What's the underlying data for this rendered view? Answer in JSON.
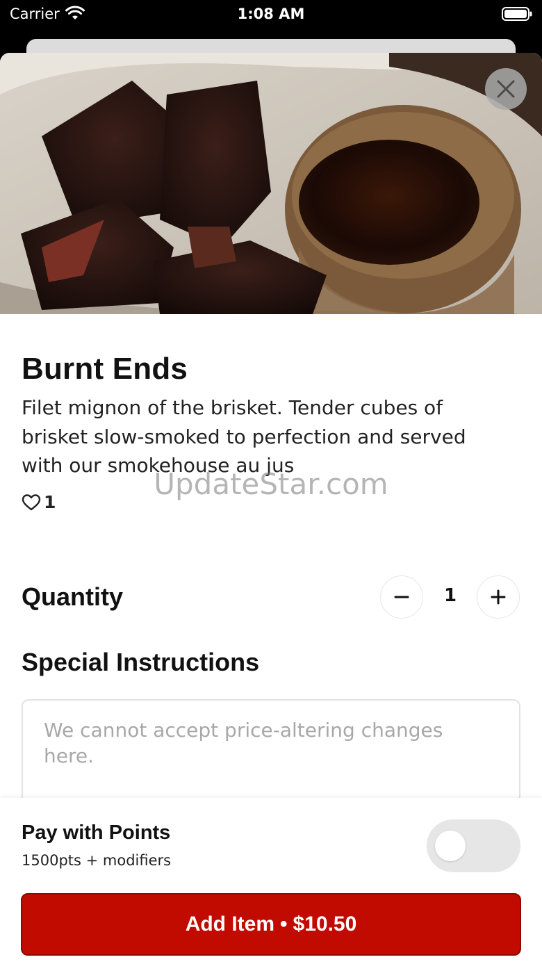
{
  "status_bar": {
    "carrier": "Carrier",
    "time": "1:08 AM"
  },
  "item": {
    "title": "Burnt Ends",
    "description": "Filet mignon of the brisket. Tender cubes of brisket slow-smoked to perfection and served with our smokehouse au jus",
    "likes": "1"
  },
  "watermark": "UpdateStar.com",
  "quantity": {
    "label": "Quantity",
    "value": "1"
  },
  "special_instructions": {
    "label": "Special Instructions",
    "placeholder": "We cannot accept price-altering changes here."
  },
  "points": {
    "title": "Pay with Points",
    "subtitle": "1500pts + modifiers",
    "enabled": false
  },
  "add_button": {
    "label": "Add Item",
    "separator": "•",
    "price": "$10.50"
  },
  "colors": {
    "accent": "#c10a00",
    "text": "#111111",
    "placeholder": "#a8a8a8"
  }
}
